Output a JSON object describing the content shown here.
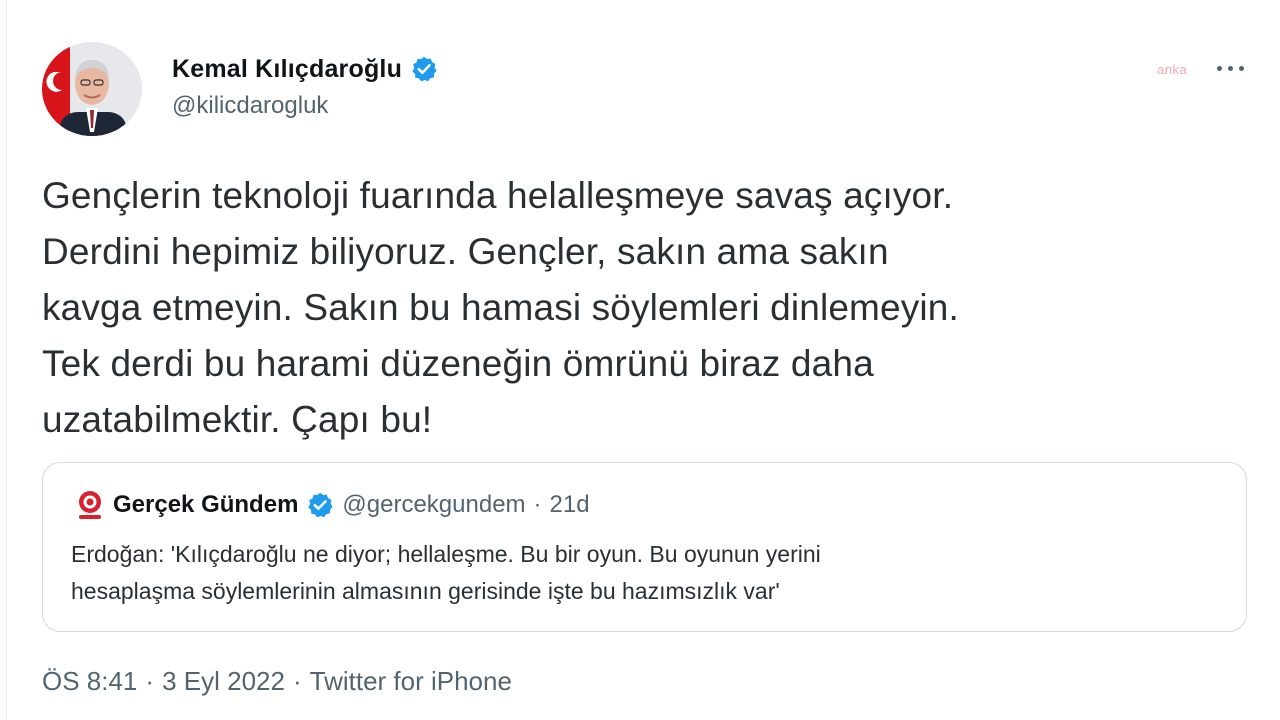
{
  "author": {
    "name": "Kemal Kılıçdaroğlu",
    "handle": "@kilicdarogluk",
    "verified_icon": "verified-badge-icon",
    "avatar_icon": "user-avatar"
  },
  "watermark": "anka",
  "tweet": {
    "lines": [
      "Gençlerin teknoloji fuarında helalleşmeye savaş açıyor.",
      "Derdini hepimiz biliyoruz. Gençler, sakın ama sakın",
      "kavga etmeyin. Sakın bu hamasi söylemleri dinlemeyin.",
      "Tek derdi bu harami düzeneğin ömrünü biraz daha",
      "uzatabilmektir. Çapı bu!"
    ]
  },
  "quote": {
    "name": "Gerçek Gündem",
    "handle": "@gercekgundem",
    "separator": "·",
    "time": "21d",
    "lines": [
      "Erdoğan: 'Kılıçdaroğlu ne diyor; hellaleşme. Bu bir oyun. Bu oyunun yerini",
      "hesaplaşma söylemlerinin almasının gerisinde işte bu hazımsızlık var'"
    ],
    "logo_icon": "gercek-gundem-logo-icon"
  },
  "meta": {
    "time": "ÖS 8:41",
    "sep1": "·",
    "date": "3 Eyl 2022",
    "sep2": "·",
    "source": "Twitter for iPhone"
  },
  "colors": {
    "verified": "#1d9bf0",
    "secondary_text": "#536471",
    "border": "#cfd9de",
    "quote_logo": "#d8212f"
  }
}
